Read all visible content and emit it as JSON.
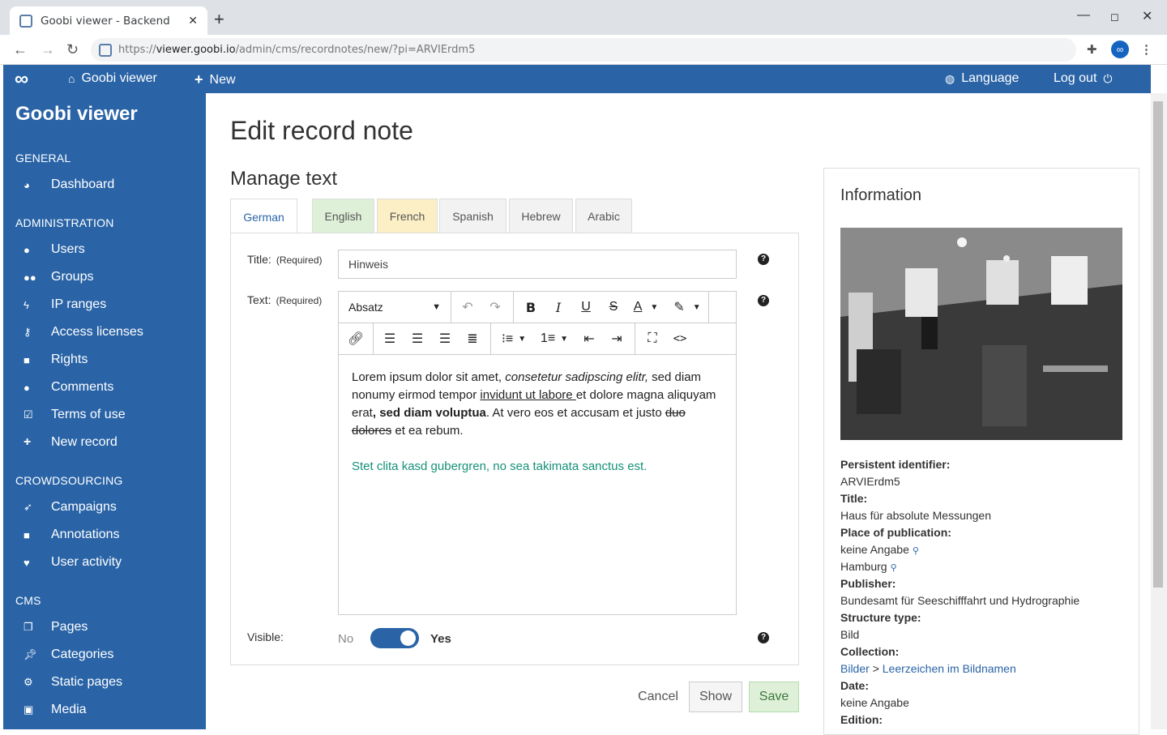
{
  "browser": {
    "tab_title": "Goobi viewer - Backend",
    "url_prefix": "https://",
    "url_host": "viewer.goobi.io",
    "url_path": "/admin/cms/recordnotes/new/?pi=ARVIErdm5"
  },
  "topbar": {
    "home_label": "Goobi viewer",
    "new_label": "New",
    "language_label": "Language",
    "logout_label": "Log out"
  },
  "sidebar": {
    "title": "Goobi viewer",
    "sections": {
      "general": "GENERAL",
      "administration": "ADMINISTRATION",
      "crowdsourcing": "CROWDSOURCING",
      "cms": "CMS"
    },
    "items": {
      "dashboard": "Dashboard",
      "users": "Users",
      "groups": "Groups",
      "ip_ranges": "IP ranges",
      "access_licenses": "Access licenses",
      "rights": "Rights",
      "comments": "Comments",
      "terms": "Terms of use",
      "new_record": "New record",
      "campaigns": "Campaigns",
      "annotations": "Annotations",
      "user_activity": "User activity",
      "pages": "Pages",
      "categories": "Categories",
      "static_pages": "Static pages",
      "media": "Media"
    }
  },
  "page": {
    "heading": "Edit record note",
    "subheading": "Manage text",
    "languages": [
      "German",
      "English",
      "French",
      "Spanish",
      "Hebrew",
      "Arabic"
    ],
    "language_colors": {
      "English": "#dff0d8",
      "French": "#fcefc5"
    },
    "title_label": "Title:",
    "required": "(Required)",
    "title_value": "Hinweis",
    "text_label": "Text:",
    "format_select": "Absatz",
    "text_p1": {
      "a": "Lorem ipsum dolor sit amet, ",
      "b_italic": "consetetur sadipscing elitr,",
      "c": " sed diam nonumy eirmod tempor ",
      "d_underline": "invidunt ut labore ",
      "e": "et dolore magna aliquyam erat",
      "f_bold": ", sed diam voluptua",
      "g": ". At vero eos et accusam et justo ",
      "h_strike": "duo dolores",
      "i": " et ea rebum."
    },
    "text_p2": "Stet clita kasd gubergren, no sea takimata sanctus est.",
    "visible_label": "Visible:",
    "visible_no": "No",
    "visible_yes": "Yes",
    "cancel": "Cancel",
    "show": "Show",
    "save": "Save"
  },
  "info": {
    "heading": "Information",
    "pi_label": "Persistent identifier:",
    "pi_value": "ARVIErdm5",
    "title_label": "Title:",
    "title_value": "Haus für absolute Messungen",
    "place_label": "Place of publication:",
    "place_1": "keine Angabe",
    "place_2": "Hamburg",
    "publisher_label": "Publisher:",
    "publisher_value": "Bundesamt für Seeschifffahrt und Hydrographie",
    "structure_label": "Structure type:",
    "structure_value": "Bild",
    "collection_label": "Collection:",
    "collection_1": "Bilder",
    "collection_sep": ">",
    "collection_2": "Leerzeichen im Bildnamen",
    "date_label": "Date:",
    "date_value": "keine Angabe",
    "edition_label": "Edition:"
  }
}
